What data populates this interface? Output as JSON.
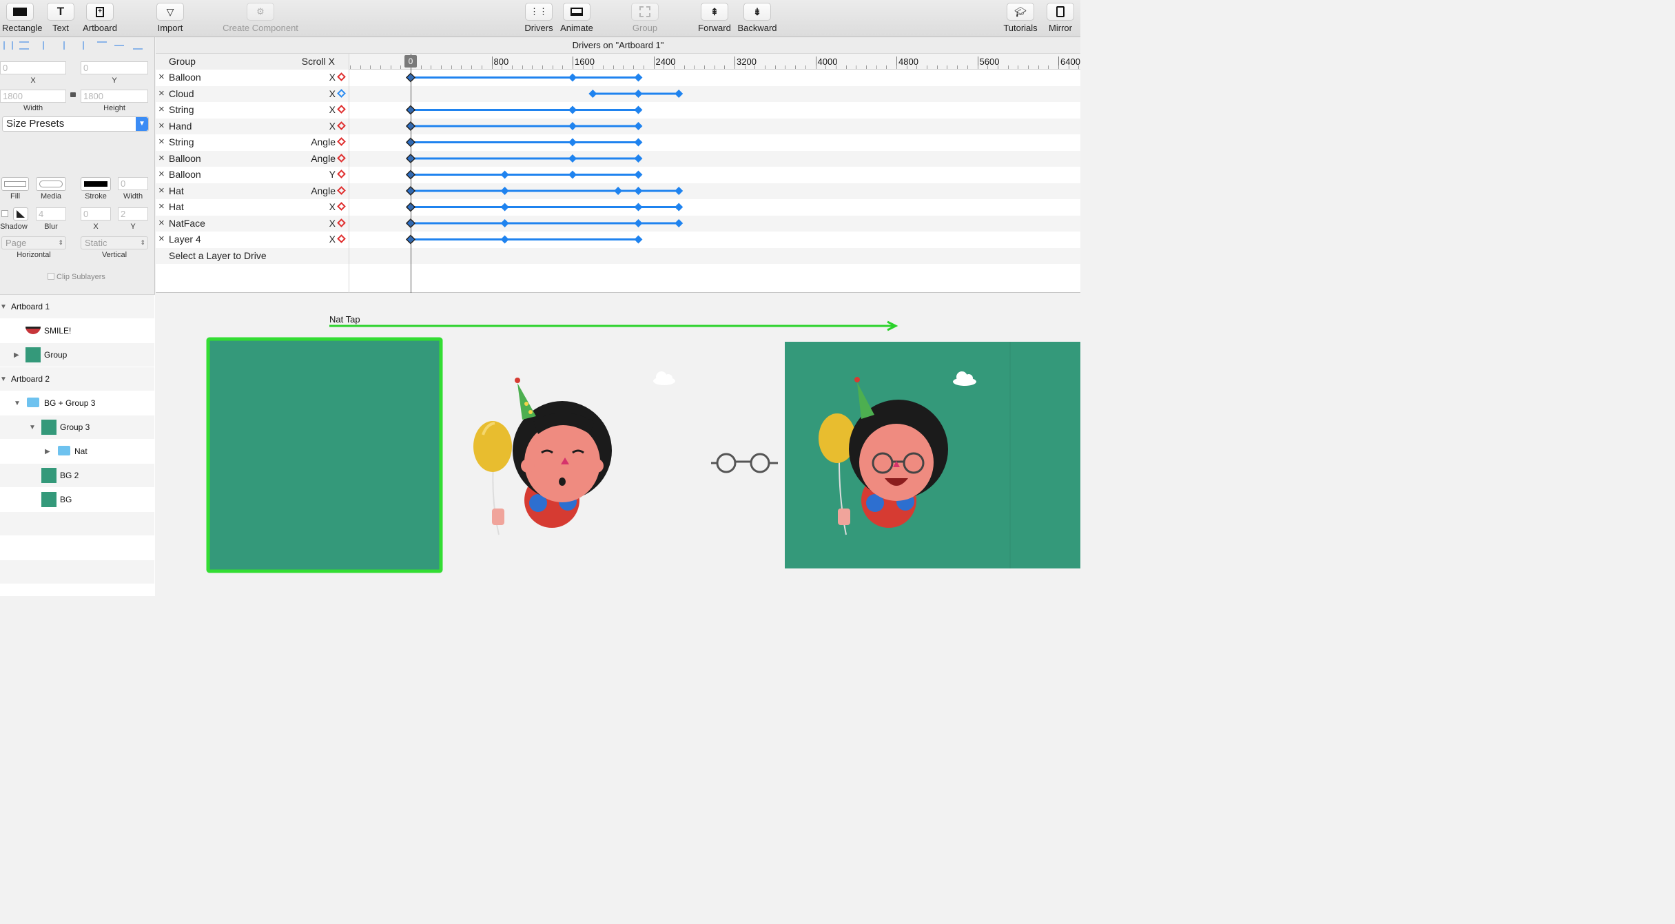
{
  "toolbar": {
    "rectangle": "Rectangle",
    "text": "Text",
    "artboard": "Artboard",
    "import": "Import",
    "create_component": "Create Component",
    "drivers": "Drivers",
    "animate": "Animate",
    "group": "Group",
    "forward": "Forward",
    "backward": "Backward",
    "tutorials": "Tutorials",
    "mirror": "Mirror"
  },
  "inspector": {
    "x_value": "0",
    "x_label": "X",
    "y_value": "0",
    "y_label": "Y",
    "width_value": "1800",
    "width_label": "Width",
    "height_value": "1800",
    "height_label": "Height",
    "size_presets": "Size Presets",
    "fill_label": "Fill",
    "media_label": "Media",
    "stroke_label": "Stroke",
    "stroke_width_value": "0",
    "stroke_width_label": "Width",
    "shadow_label": "Shadow",
    "blur_value": "4",
    "blur_label": "Blur",
    "shadow_x_value": "0",
    "shadow_x_label": "X",
    "shadow_y_value": "2",
    "shadow_y_label": "Y",
    "horizontal_value": "Page",
    "horizontal_label": "Horizontal",
    "vertical_value": "Static",
    "vertical_label": "Vertical",
    "clip_sublayers": "Clip Sublayers"
  },
  "layers": [
    {
      "label": "Artboard 1"
    },
    {
      "label": "SMILE!"
    },
    {
      "label": "Group"
    },
    {
      "label": "Artboard 2"
    },
    {
      "label": "BG + Group 3"
    },
    {
      "label": "Group 3"
    },
    {
      "label": "Nat"
    },
    {
      "label": "BG 2"
    },
    {
      "label": "BG"
    }
  ],
  "drivers_panel": {
    "title": "Drivers on \"Artboard 1\"",
    "col_group": "Group",
    "col_scroll": "Scroll X",
    "playhead_label": "0",
    "ruler_labels": [
      "0",
      "800",
      "1600",
      "2400",
      "3200",
      "4000",
      "4800",
      "5600",
      "6400"
    ],
    "rows": [
      {
        "layer": "Balloon",
        "prop": "X",
        "keys": [
          0,
          1600,
          2250
        ]
      },
      {
        "layer": "Cloud",
        "prop": "X",
        "keys": [
          1800,
          2250,
          2650
        ]
      },
      {
        "layer": "String",
        "prop": "X",
        "keys": [
          0,
          1600,
          2250
        ]
      },
      {
        "layer": "Hand",
        "prop": "X",
        "keys": [
          0,
          1600,
          2250
        ]
      },
      {
        "layer": "String",
        "prop": "Angle",
        "keys": [
          0,
          1600,
          2250
        ]
      },
      {
        "layer": "Balloon",
        "prop": "Angle",
        "keys": [
          0,
          1600,
          2250
        ]
      },
      {
        "layer": "Balloon",
        "prop": "Y",
        "keys": [
          0,
          930,
          1600,
          2250
        ]
      },
      {
        "layer": "Hat",
        "prop": "Angle",
        "keys": [
          0,
          930,
          2050,
          2250,
          2650
        ]
      },
      {
        "layer": "Hat",
        "prop": "X",
        "keys": [
          0,
          930,
          2250,
          2650
        ]
      },
      {
        "layer": "NatFace",
        "prop": "X",
        "keys": [
          0,
          930,
          2250,
          2650
        ]
      },
      {
        "layer": "Layer 4",
        "prop": "X",
        "keys": [
          0,
          930,
          2250
        ]
      }
    ],
    "select_prompt": "Select a Layer to Drive"
  },
  "canvas": {
    "nat_tap_label": "Nat Tap",
    "artboard_color": "#34997a",
    "selection_color": "#3ddc3d"
  }
}
